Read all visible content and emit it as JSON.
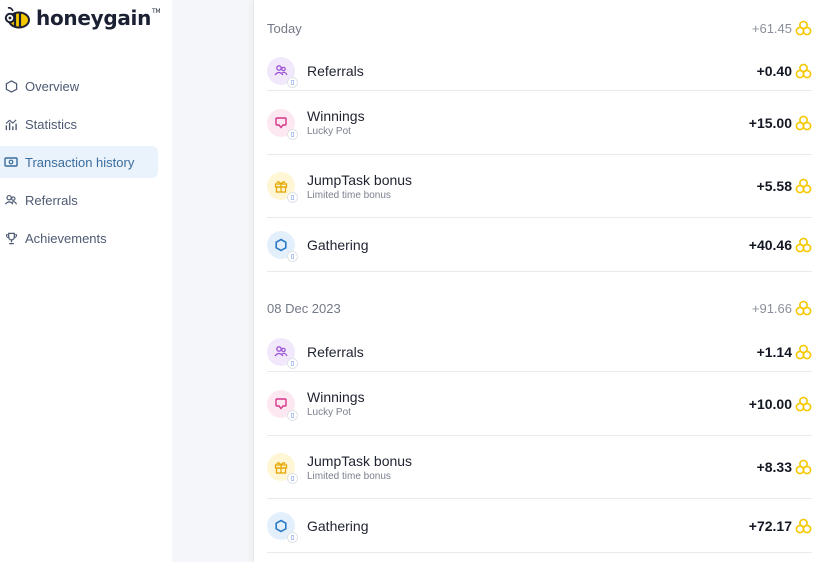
{
  "app": {
    "logo_text": "honeygain",
    "logo_tm": "TM"
  },
  "colors": {
    "accent": "#f5c800",
    "active_nav_bg": "#eaf3fb",
    "referrals_icon": "#9b4fd6",
    "winnings_icon": "#d6338a",
    "jumptask_icon": "#e6a700",
    "gathering_icon": "#2a79c7"
  },
  "sidebar": {
    "items": [
      {
        "label": "Overview",
        "icon": "hexagon-icon",
        "active": false
      },
      {
        "label": "Statistics",
        "icon": "chart-icon",
        "active": false
      },
      {
        "label": "Transaction history",
        "icon": "wallet-icon",
        "active": true
      },
      {
        "label": "Referrals",
        "icon": "users-icon",
        "active": false
      },
      {
        "label": "Achievements",
        "icon": "trophy-icon",
        "active": false
      }
    ]
  },
  "days": [
    {
      "date": "Today",
      "total": "+61.45",
      "transactions": [
        {
          "title": "Referrals",
          "subtitle": "",
          "amount": "+0.40",
          "kind": "referrals"
        },
        {
          "title": "Winnings",
          "subtitle": "Lucky Pot",
          "amount": "+15.00",
          "kind": "winnings"
        },
        {
          "title": "JumpTask bonus",
          "subtitle": "Limited time bonus",
          "amount": "+5.58",
          "kind": "jumptask"
        },
        {
          "title": "Gathering",
          "subtitle": "",
          "amount": "+40.46",
          "kind": "gathering"
        }
      ]
    },
    {
      "date": "08 Dec 2023",
      "total": "+91.66",
      "transactions": [
        {
          "title": "Referrals",
          "subtitle": "",
          "amount": "+1.14",
          "kind": "referrals"
        },
        {
          "title": "Winnings",
          "subtitle": "Lucky Pot",
          "amount": "+10.00",
          "kind": "winnings"
        },
        {
          "title": "JumpTask bonus",
          "subtitle": "Limited time bonus",
          "amount": "+8.33",
          "kind": "jumptask"
        },
        {
          "title": "Gathering",
          "subtitle": "",
          "amount": "+72.17",
          "kind": "gathering"
        }
      ]
    }
  ]
}
